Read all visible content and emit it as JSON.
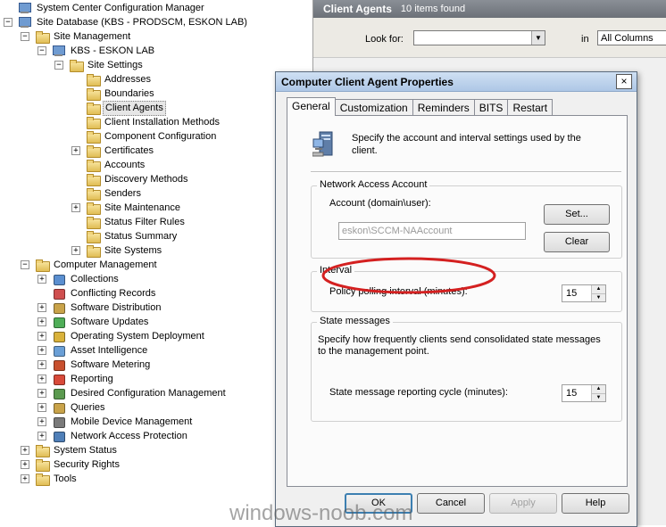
{
  "tree": {
    "items": [
      {
        "label": "System Center Configuration Manager",
        "level": 0,
        "expander": "",
        "icon": "computer"
      },
      {
        "label": "Site Database  (KBS - PRODSCM, ESKON LAB)",
        "level": 0,
        "expander": "−",
        "icon": "computer"
      },
      {
        "label": "Site Management",
        "level": 1,
        "expander": "−",
        "icon": "folder"
      },
      {
        "label": "KBS - ESKON LAB",
        "level": 2,
        "expander": "−",
        "icon": "computer"
      },
      {
        "label": "Site Settings",
        "level": 3,
        "expander": "−",
        "icon": "folder"
      },
      {
        "label": "Addresses",
        "level": 4,
        "expander": "",
        "icon": "folder"
      },
      {
        "label": "Boundaries",
        "level": 4,
        "expander": "",
        "icon": "folder"
      },
      {
        "label": "Client Agents",
        "level": 4,
        "expander": "",
        "icon": "folder",
        "selected": true
      },
      {
        "label": "Client Installation Methods",
        "level": 4,
        "expander": "",
        "icon": "folder"
      },
      {
        "label": "Component Configuration",
        "level": 4,
        "expander": "",
        "icon": "folder"
      },
      {
        "label": "Certificates",
        "level": 4,
        "expander": "+",
        "icon": "folder"
      },
      {
        "label": "Accounts",
        "level": 4,
        "expander": "",
        "icon": "folder"
      },
      {
        "label": "Discovery Methods",
        "level": 4,
        "expander": "",
        "icon": "folder"
      },
      {
        "label": "Senders",
        "level": 4,
        "expander": "",
        "icon": "folder"
      },
      {
        "label": "Site Maintenance",
        "level": 4,
        "expander": "+",
        "icon": "folder"
      },
      {
        "label": "Status Filter Rules",
        "level": 4,
        "expander": "",
        "icon": "folder"
      },
      {
        "label": "Status Summary",
        "level": 4,
        "expander": "",
        "icon": "folder"
      },
      {
        "label": "Site Systems",
        "level": 4,
        "expander": "+",
        "icon": "folder"
      },
      {
        "label": "Computer Management",
        "level": 1,
        "expander": "−",
        "icon": "folder"
      },
      {
        "label": "Collections",
        "level": 2,
        "expander": "+",
        "icon": "colored",
        "color": "#5b8fd0"
      },
      {
        "label": "Conflicting Records",
        "level": 2,
        "expander": "",
        "icon": "colored",
        "color": "#cf4f4f"
      },
      {
        "label": "Software Distribution",
        "level": 2,
        "expander": "+",
        "icon": "colored",
        "color": "#c9a34a"
      },
      {
        "label": "Software Updates",
        "level": 2,
        "expander": "+",
        "icon": "colored",
        "color": "#4fae58"
      },
      {
        "label": "Operating System Deployment",
        "level": 2,
        "expander": "+",
        "icon": "colored",
        "color": "#d9b23b"
      },
      {
        "label": "Asset Intelligence",
        "level": 2,
        "expander": "+",
        "icon": "colored",
        "color": "#6a9fd6"
      },
      {
        "label": "Software Metering",
        "level": 2,
        "expander": "+",
        "icon": "colored",
        "color": "#c8502e"
      },
      {
        "label": "Reporting",
        "level": 2,
        "expander": "+",
        "icon": "colored",
        "color": "#d84a3a"
      },
      {
        "label": "Desired Configuration Management",
        "level": 2,
        "expander": "+",
        "icon": "colored",
        "color": "#5b9a4f"
      },
      {
        "label": "Queries",
        "level": 2,
        "expander": "+",
        "icon": "colored",
        "color": "#c9a34a"
      },
      {
        "label": "Mobile Device Management",
        "level": 2,
        "expander": "+",
        "icon": "colored",
        "color": "#7a7a7a"
      },
      {
        "label": "Network Access Protection",
        "level": 2,
        "expander": "+",
        "icon": "colored",
        "color": "#4f7fb8"
      },
      {
        "label": "System Status",
        "level": 1,
        "expander": "+",
        "icon": "folder"
      },
      {
        "label": "Security Rights",
        "level": 1,
        "expander": "+",
        "icon": "folder"
      },
      {
        "label": "Tools",
        "level": 1,
        "expander": "+",
        "icon": "folder"
      }
    ]
  },
  "rightpane": {
    "title": "Client Agents",
    "count": "10 items found",
    "look_for_label": "Look for:",
    "look_for_value": "",
    "in_label": "in",
    "in_value": "All Columns"
  },
  "dialog": {
    "title": "Computer Client Agent Properties",
    "close_glyph": "×",
    "tabs": [
      "General",
      "Customization",
      "Reminders",
      "BITS",
      "Restart"
    ],
    "active_tab": "General",
    "intro": "Specify the account and interval settings used by the client.",
    "network_access": {
      "title": "Network Access Account",
      "account_label": "Account (domain\\user):",
      "account_value": "eskon\\SCCM-NAAccount",
      "set_button": "Set...",
      "clear_button": "Clear"
    },
    "interval": {
      "title": "Interval",
      "polling_label": "Policy polling interval (minutes):",
      "polling_value": "15"
    },
    "state_messages": {
      "title": "State messages",
      "description": "Specify how frequently clients send consolidated state messages to the management point.",
      "cycle_label": "State message reporting cycle (minutes):",
      "cycle_value": "15"
    },
    "buttons": {
      "ok": "OK",
      "cancel": "Cancel",
      "apply": "Apply",
      "help": "Help"
    },
    "annotation_color": "#d42020"
  },
  "watermark": "windows-noob.com"
}
